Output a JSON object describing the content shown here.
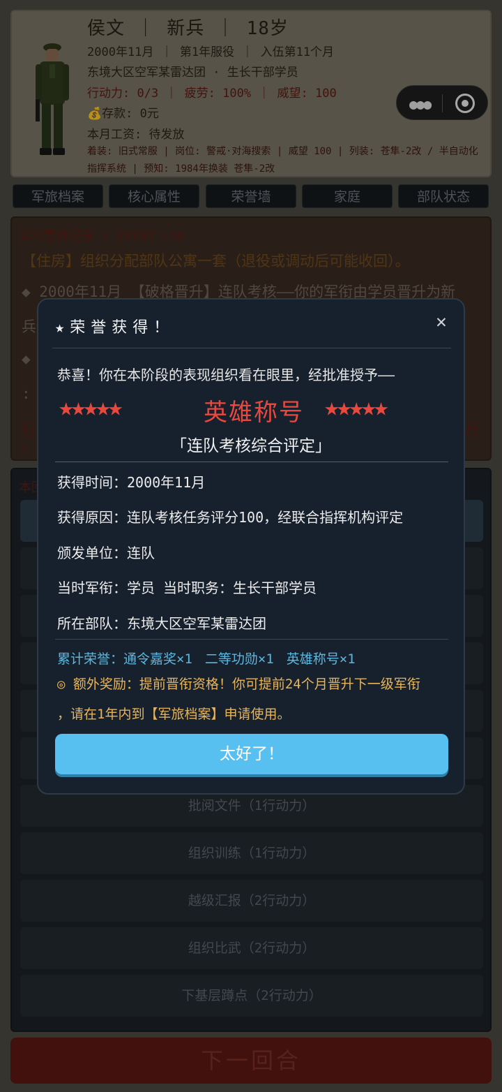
{
  "profile": {
    "name_line": "侯文 ｜ 新兵 ｜ 18岁",
    "date_line": "2000年11月 ｜ 第1年服役 ｜ 入伍第11个月",
    "unit_line": "东境大区空军某雷达团 · 生长干部学员",
    "stats_line": "行动力: 0/3 ｜ 疲劳: 100% ｜ 威望: 100",
    "savings": "💰存款: 0元",
    "salary": "本月工资: 待发放",
    "equip_line1": "着装: 旧式常服 | 岗位: 警戒·对海搜索 | 威望 100 | 列装: 苍隼-2改 / 半自动化",
    "equip_line2": "指挥系统 | 预知: 1984年换装 苍隼-2改"
  },
  "capsule": {
    "more_icon": "more-dots-icon",
    "close_icon": "target-circle-icon"
  },
  "tabs": [
    "军旅档案",
    "核心属性",
    "荣誉墙",
    "家庭",
    "部队状态"
  ],
  "events": {
    "title": "实时事件记录 / EVENT LOG",
    "line1": "【住房】组织分配部队公寓一套（退役或调动后可能收回）。",
    "line2": "◆ 2000年11月 【破格晋升】连队考核——你的军衔由学员晋升为新",
    "line3_head": "兵",
    "line4_head": "◆",
    "line5_head": ":",
    "line6_head": "行",
    "line6_tail": "月",
    "line7_head": "。"
  },
  "actions": {
    "label": "本回",
    "buttons": [
      "",
      "",
      "",
      "",
      "",
      "",
      "批阅文件（1行动力）",
      "组织训练（1行动力）",
      "越级汇报（2行动力）",
      "组织比武（2行动力）",
      "下基层蹲点（2行动力）"
    ]
  },
  "next_turn": "下一回合",
  "modal": {
    "title": "★荣誉获得！",
    "close": "✕",
    "congrats": "恭喜！你在本阶段的表现组织看在眼里，经批准授予——",
    "stars": "★★★★★",
    "award_name": "英雄称号",
    "subtitle": "「连队考核综合评定」",
    "time_row": "获得时间：2000年11月",
    "reason_row": "获得原因：连队考核任务评分100，经联合指挥机构评定",
    "issuer_row": "颁发单位：连队",
    "rank_row": "当时军衔：学员  当时职务：生长干部学员",
    "unit_row": "所在部队：东境大区空军某雷达团",
    "accum_label": "累计荣誉：",
    "accum_items": [
      "通令嘉奖×1",
      "二等功勋×1",
      "英雄称号×1"
    ],
    "extra_line1": "◎ 额外奖励：提前晋衔资格！你可提前24个月晋升下一级军衔",
    "extra_line2": "，请在1年内到【军旅档案】申请使用。",
    "ok_button": "太好了！"
  },
  "colors": {
    "modal_bg": "#17212d",
    "award_red": "#e8493f",
    "accent_blue": "#57c0f0",
    "accum_blue": "#5ab8e0",
    "extra_gold": "#e8b45a"
  }
}
